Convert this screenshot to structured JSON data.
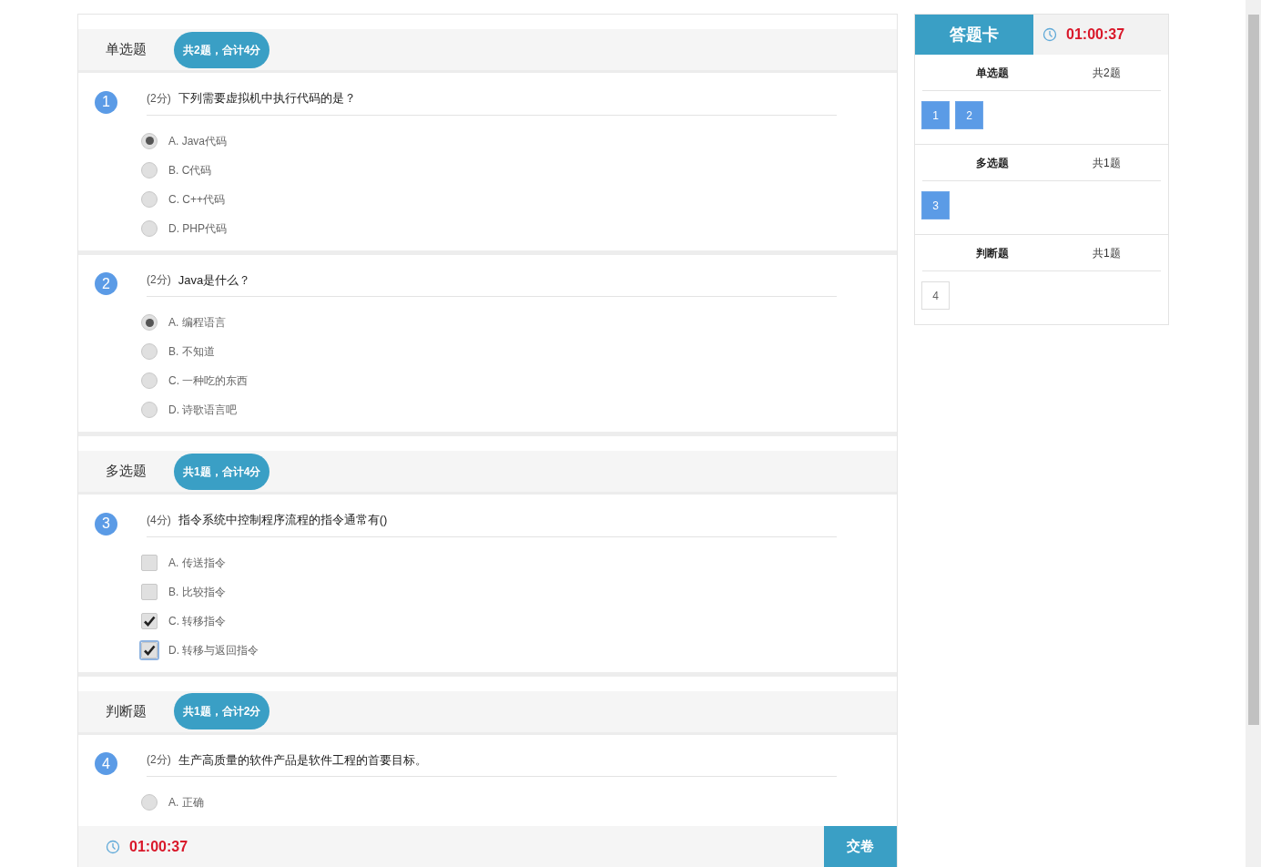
{
  "sections": [
    {
      "title": "单选题",
      "summary": "共2题，合计4分",
      "questions": [
        {
          "number": "1",
          "score": "(2分)",
          "text": "下列需要虚拟机中执行代码的是？",
          "kind": "radio",
          "options": [
            {
              "label": "A. Java代码",
              "selected": true,
              "focused": false
            },
            {
              "label": "B. C代码",
              "selected": false,
              "focused": false
            },
            {
              "label": "C. C++代码",
              "selected": false,
              "focused": false
            },
            {
              "label": "D. PHP代码",
              "selected": false,
              "focused": false
            }
          ]
        },
        {
          "number": "2",
          "score": "(2分)",
          "text": "Java是什么？",
          "kind": "radio",
          "options": [
            {
              "label": "A. 编程语言",
              "selected": true,
              "focused": false
            },
            {
              "label": "B. 不知道",
              "selected": false,
              "focused": false
            },
            {
              "label": "C. 一种吃的东西",
              "selected": false,
              "focused": false
            },
            {
              "label": "D. 诗歌语言吧",
              "selected": false,
              "focused": false
            }
          ]
        }
      ]
    },
    {
      "title": "多选题",
      "summary": "共1题，合计4分",
      "questions": [
        {
          "number": "3",
          "score": "(4分)",
          "text": "指令系统中控制程序流程的指令通常有()",
          "kind": "checkbox",
          "options": [
            {
              "label": "A. 传送指令",
              "selected": false,
              "focused": false
            },
            {
              "label": "B. 比较指令",
              "selected": false,
              "focused": false
            },
            {
              "label": "C. 转移指令",
              "selected": true,
              "focused": false
            },
            {
              "label": "D. 转移与返回指令",
              "selected": true,
              "focused": true
            }
          ]
        }
      ]
    },
    {
      "title": "判断题",
      "summary": "共1题，合计2分",
      "questions": [
        {
          "number": "4",
          "score": "(2分)",
          "text": "生产高质量的软件产品是软件工程的首要目标。",
          "kind": "radio",
          "options": [
            {
              "label": "A. 正确",
              "selected": false,
              "focused": false
            }
          ]
        }
      ]
    }
  ],
  "footer": {
    "timer": "01:00:37",
    "submit": "交卷"
  },
  "answer_card": {
    "title": "答题卡",
    "timer": "01:00:37",
    "groups": [
      {
        "title": "单选题",
        "count": "共2题",
        "items": [
          {
            "label": "1",
            "answered": true
          },
          {
            "label": "2",
            "answered": true
          }
        ]
      },
      {
        "title": "多选题",
        "count": "共1题",
        "items": [
          {
            "label": "3",
            "answered": true
          }
        ]
      },
      {
        "title": "判断题",
        "count": "共1题",
        "items": [
          {
            "label": "4",
            "answered": false
          }
        ]
      }
    ]
  }
}
